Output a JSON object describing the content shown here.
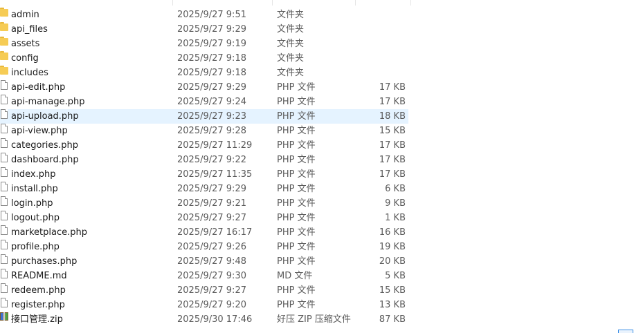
{
  "files": [
    {
      "name": "admin",
      "date": "2025/9/27 9:51",
      "type": "文件夹",
      "size": "",
      "kind": "folder"
    },
    {
      "name": "api_files",
      "date": "2025/9/27 9:29",
      "type": "文件夹",
      "size": "",
      "kind": "folder"
    },
    {
      "name": "assets",
      "date": "2025/9/27 9:19",
      "type": "文件夹",
      "size": "",
      "kind": "folder"
    },
    {
      "name": "config",
      "date": "2025/9/27 9:18",
      "type": "文件夹",
      "size": "",
      "kind": "folder"
    },
    {
      "name": "includes",
      "date": "2025/9/27 9:18",
      "type": "文件夹",
      "size": "",
      "kind": "folder"
    },
    {
      "name": "api-edit.php",
      "date": "2025/9/27 9:29",
      "type": "PHP 文件",
      "size": "17 KB",
      "kind": "file"
    },
    {
      "name": "api-manage.php",
      "date": "2025/9/27 9:24",
      "type": "PHP 文件",
      "size": "17 KB",
      "kind": "file"
    },
    {
      "name": "api-upload.php",
      "date": "2025/9/27 9:23",
      "type": "PHP 文件",
      "size": "18 KB",
      "kind": "file",
      "selected": true
    },
    {
      "name": "api-view.php",
      "date": "2025/9/27 9:28",
      "type": "PHP 文件",
      "size": "15 KB",
      "kind": "file"
    },
    {
      "name": "categories.php",
      "date": "2025/9/27 11:29",
      "type": "PHP 文件",
      "size": "17 KB",
      "kind": "file"
    },
    {
      "name": "dashboard.php",
      "date": "2025/9/27 9:22",
      "type": "PHP 文件",
      "size": "17 KB",
      "kind": "file"
    },
    {
      "name": "index.php",
      "date": "2025/9/27 11:35",
      "type": "PHP 文件",
      "size": "17 KB",
      "kind": "file"
    },
    {
      "name": "install.php",
      "date": "2025/9/27 9:29",
      "type": "PHP 文件",
      "size": "6 KB",
      "kind": "file"
    },
    {
      "name": "login.php",
      "date": "2025/9/27 9:21",
      "type": "PHP 文件",
      "size": "9 KB",
      "kind": "file"
    },
    {
      "name": "logout.php",
      "date": "2025/9/27 9:27",
      "type": "PHP 文件",
      "size": "1 KB",
      "kind": "file"
    },
    {
      "name": "marketplace.php",
      "date": "2025/9/27 16:17",
      "type": "PHP 文件",
      "size": "16 KB",
      "kind": "file"
    },
    {
      "name": "profile.php",
      "date": "2025/9/27 9:26",
      "type": "PHP 文件",
      "size": "19 KB",
      "kind": "file"
    },
    {
      "name": "purchases.php",
      "date": "2025/9/27 9:48",
      "type": "PHP 文件",
      "size": "20 KB",
      "kind": "file"
    },
    {
      "name": "README.md",
      "date": "2025/9/27 9:30",
      "type": "MD 文件",
      "size": "5 KB",
      "kind": "file"
    },
    {
      "name": "redeem.php",
      "date": "2025/9/27 9:27",
      "type": "PHP 文件",
      "size": "15 KB",
      "kind": "file"
    },
    {
      "name": "register.php",
      "date": "2025/9/27 9:20",
      "type": "PHP 文件",
      "size": "13 KB",
      "kind": "file"
    },
    {
      "name": "接口管理.zip",
      "date": "2025/9/30 17:46",
      "type": "好压 ZIP 压缩文件",
      "size": "87 KB",
      "kind": "zip"
    }
  ]
}
